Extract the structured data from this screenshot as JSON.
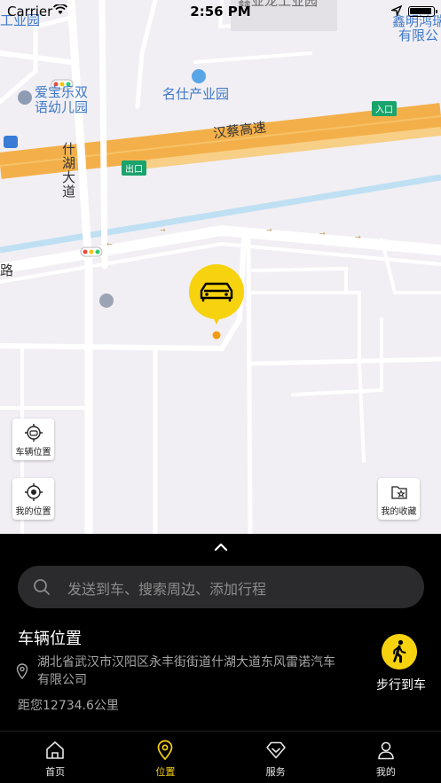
{
  "status_bar": {
    "carrier": "Carrier",
    "time": "2:56 PM"
  },
  "map": {
    "labels": {
      "top_left_fragment": "工业园",
      "top_center_fragment": "鑫亚龙工业园",
      "top_right_line1": "鑫明鸿瑞",
      "top_right_line2": "有限公",
      "kindergarten_line1": "爱宝乐双",
      "kindergarten_line2": "语幼儿园",
      "industrial_park": "名仕产业园",
      "expressway": "汉蔡高速",
      "entrance_badge": "入口",
      "exit_badge": "出口",
      "avenue": "什湖大道",
      "left_road_fragment": "路"
    },
    "buttons": {
      "vehicle_location": "车辆位置",
      "my_location": "我的位置",
      "favorites": "我的收藏"
    }
  },
  "panel": {
    "search_placeholder": "发送到车、搜索周边、添加行程",
    "section_title": "车辆位置",
    "address": "湖北省武汉市汉阳区永丰街街道什湖大道东风雷诺汽车有限公司",
    "distance": "距您12734.6公里",
    "walk_action": "步行到车"
  },
  "tabs": [
    {
      "label": "首页",
      "icon": "home-icon",
      "active": false
    },
    {
      "label": "位置",
      "icon": "location-pin-icon",
      "active": true
    },
    {
      "label": "服务",
      "icon": "diamond-icon",
      "active": false
    },
    {
      "label": "我的",
      "icon": "person-icon",
      "active": false
    }
  ],
  "colors": {
    "accent": "#f7d20f",
    "expressway": "#f5a623",
    "map_background": "#f1eff4",
    "map_label": "#3f79c8",
    "panel_background": "#000000",
    "badge_green": "#1aa36b"
  }
}
